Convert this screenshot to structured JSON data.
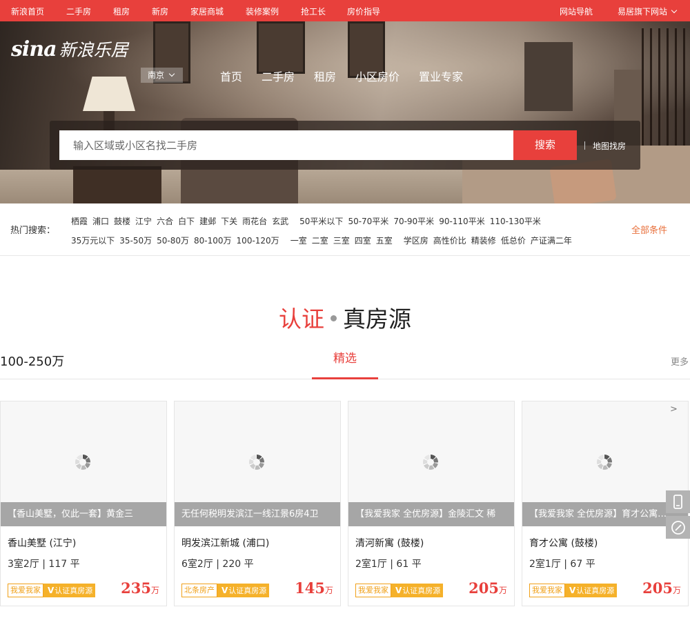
{
  "topbar": {
    "links": [
      "新浪首页",
      "二手房",
      "租房",
      "新房",
      "家居商城",
      "装修案例",
      "抢工长",
      "房价指导"
    ],
    "site_nav": "网站导航",
    "sister_sites": "易居旗下网站"
  },
  "header": {
    "logo_sina": "sina",
    "logo_text": "新浪乐居",
    "city": "南京",
    "nav": [
      "首页",
      "二手房",
      "租房",
      "小区房价",
      "置业专家"
    ]
  },
  "search": {
    "placeholder": "输入区域或小区名找二手房",
    "button": "搜索",
    "map_search": "地图找房"
  },
  "hot_search": {
    "label": "热门搜索：",
    "row1": [
      "栖霞",
      "浦口",
      "鼓楼",
      "江宁",
      "六合",
      "白下",
      "建邺",
      "下关",
      "雨花台",
      "玄武",
      "50平米以下",
      "50-70平米",
      "70-90平米",
      "90-110平米",
      "110-130平米"
    ],
    "row2": [
      "35万元以下",
      "35-50万",
      "50-80万",
      "80-100万",
      "100-120万",
      "一室",
      "二室",
      "三室",
      "四室",
      "五室",
      "学区房",
      "高性价比",
      "精装修",
      "低总价",
      "产证满二年"
    ],
    "all_conditions": "全部条件"
  },
  "section": {
    "title_red": "认证",
    "title_dark": "真房源",
    "price_range": "100-250万",
    "active_tab": "精选",
    "more": "更多"
  },
  "listings": [
    {
      "caption": "【香山美墅，仅此一套】黄金三",
      "name": "香山美墅 (江宁)",
      "spec": "3室2厅 | 117 平",
      "agency": "我爱我家",
      "verified": "认证真房源",
      "price": "235",
      "unit": "万"
    },
    {
      "caption": "无任何税明发滨江一线江景6房4卫",
      "name": "明发滨江新城 (浦口)",
      "spec": "6室2厅 | 220 平",
      "agency": "北条房产",
      "verified": "认证真房源",
      "price": "145",
      "unit": "万"
    },
    {
      "caption": "【我爱我家 全优房源】金陵汇文 稀",
      "name": "清河新寓 (鼓楼)",
      "spec": "2室1厅 | 61 平",
      "agency": "我爱我家",
      "verified": "认证真房源",
      "price": "205",
      "unit": "万"
    },
    {
      "caption": "【我爱我家 全优房源】育才公寓…",
      "name": "育才公寓 (鼓楼)",
      "spec": "2室1厅 | 67 平",
      "agency": "我爱我家",
      "verified": "认证真房源",
      "price": "205",
      "unit": "万"
    }
  ],
  "carousel_next": ">",
  "colors": {
    "brand_red": "#e8403c",
    "badge_orange": "#f5b12a",
    "caption_gray": "#a6a6a6"
  }
}
